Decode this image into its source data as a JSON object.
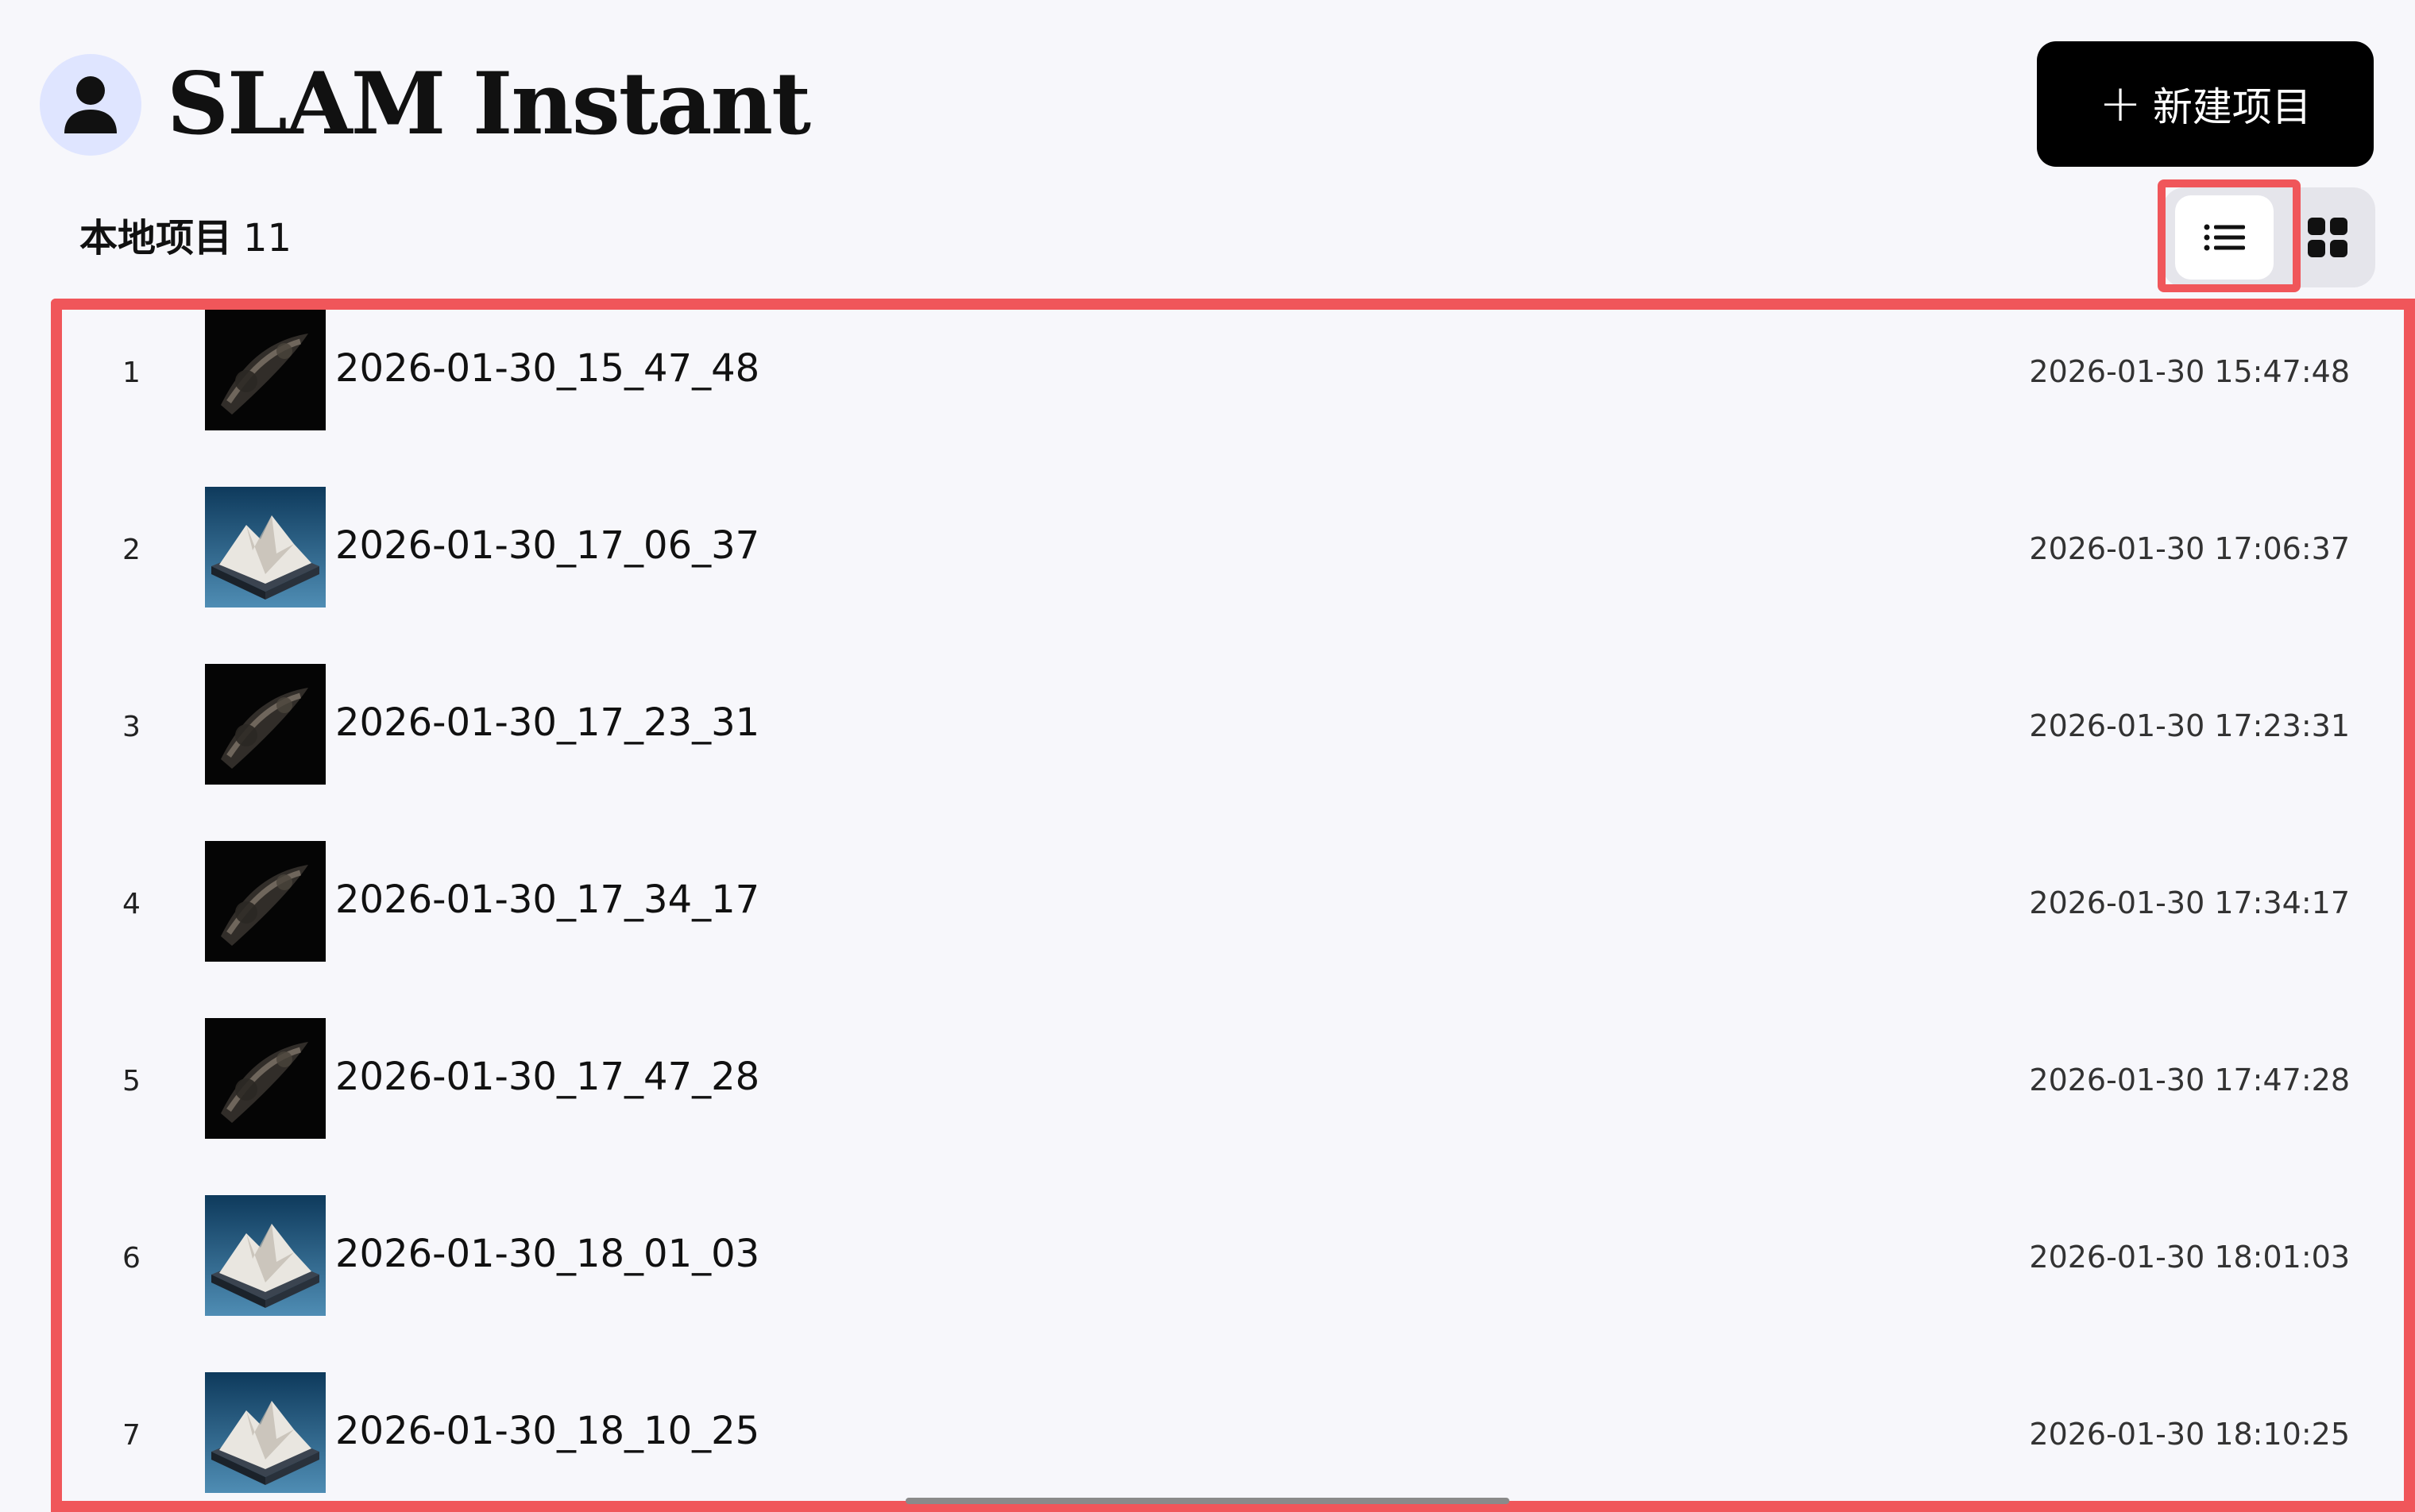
{
  "header": {
    "app_title": "SLAM Instant",
    "avatar_icon": "user-icon",
    "new_project_icon": "plus-icon",
    "new_project_label": "新建项目"
  },
  "section": {
    "title": "本地项目",
    "count": "11"
  },
  "view_toggle": {
    "list_icon": "list-view-icon",
    "grid_icon": "grid-view-icon",
    "selected": "list"
  },
  "colors": {
    "highlight": "#f0565a",
    "background": "#f7f7fb",
    "primary_button": "#000000",
    "avatar_bg": "#dfe5ff"
  },
  "projects": [
    {
      "index": "1",
      "name": "2026-01-30_15_47_48",
      "time": "2026-01-30 15:47:48",
      "thumb": "dark-pointcloud"
    },
    {
      "index": "2",
      "name": "2026-01-30_17_06_37",
      "time": "2026-01-30 17:06:37",
      "thumb": "mountain-model"
    },
    {
      "index": "3",
      "name": "2026-01-30_17_23_31",
      "time": "2026-01-30 17:23:31",
      "thumb": "dark-pointcloud"
    },
    {
      "index": "4",
      "name": "2026-01-30_17_34_17",
      "time": "2026-01-30 17:34:17",
      "thumb": "dark-pointcloud"
    },
    {
      "index": "5",
      "name": "2026-01-30_17_47_28",
      "time": "2026-01-30 17:47:28",
      "thumb": "dark-pointcloud"
    },
    {
      "index": "6",
      "name": "2026-01-30_18_01_03",
      "time": "2026-01-30 18:01:03",
      "thumb": "mountain-model"
    },
    {
      "index": "7",
      "name": "2026-01-30_18_10_25",
      "time": "2026-01-30 18:10:25",
      "thumb": "mountain-model"
    }
  ]
}
